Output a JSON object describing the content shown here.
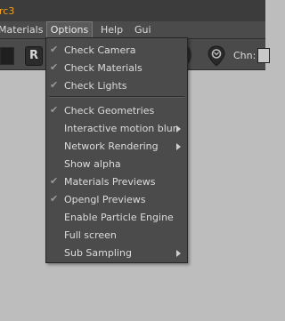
{
  "app": {
    "title_fragment": "rc3"
  },
  "menubar": {
    "items": [
      "Materials",
      "Options",
      "Help",
      "Gui"
    ]
  },
  "toolbar": {
    "r_button_label": "R",
    "chn_label": "Chn:"
  },
  "options_menu": {
    "items": [
      {
        "label": "Check Camera",
        "checked": true,
        "submenu": false
      },
      {
        "label": "Check Materials",
        "checked": true,
        "submenu": false
      },
      {
        "label": "Check Lights",
        "checked": true,
        "submenu": false
      },
      {
        "label": "Check Geometries",
        "checked": true,
        "submenu": false
      },
      {
        "label": "Interactive motion blur",
        "checked": false,
        "submenu": true
      },
      {
        "label": "Network Rendering",
        "checked": false,
        "submenu": true
      },
      {
        "label": "Show alpha",
        "checked": false,
        "submenu": false
      },
      {
        "label": "Materials Previews",
        "checked": true,
        "submenu": false
      },
      {
        "label": "Opengl Previews",
        "checked": true,
        "submenu": false
      },
      {
        "label": "Enable Particle Engine",
        "checked": false,
        "submenu": false
      },
      {
        "label": "Full screen",
        "checked": false,
        "submenu": false
      },
      {
        "label": "Sub Sampling",
        "checked": false,
        "submenu": true
      }
    ]
  }
}
